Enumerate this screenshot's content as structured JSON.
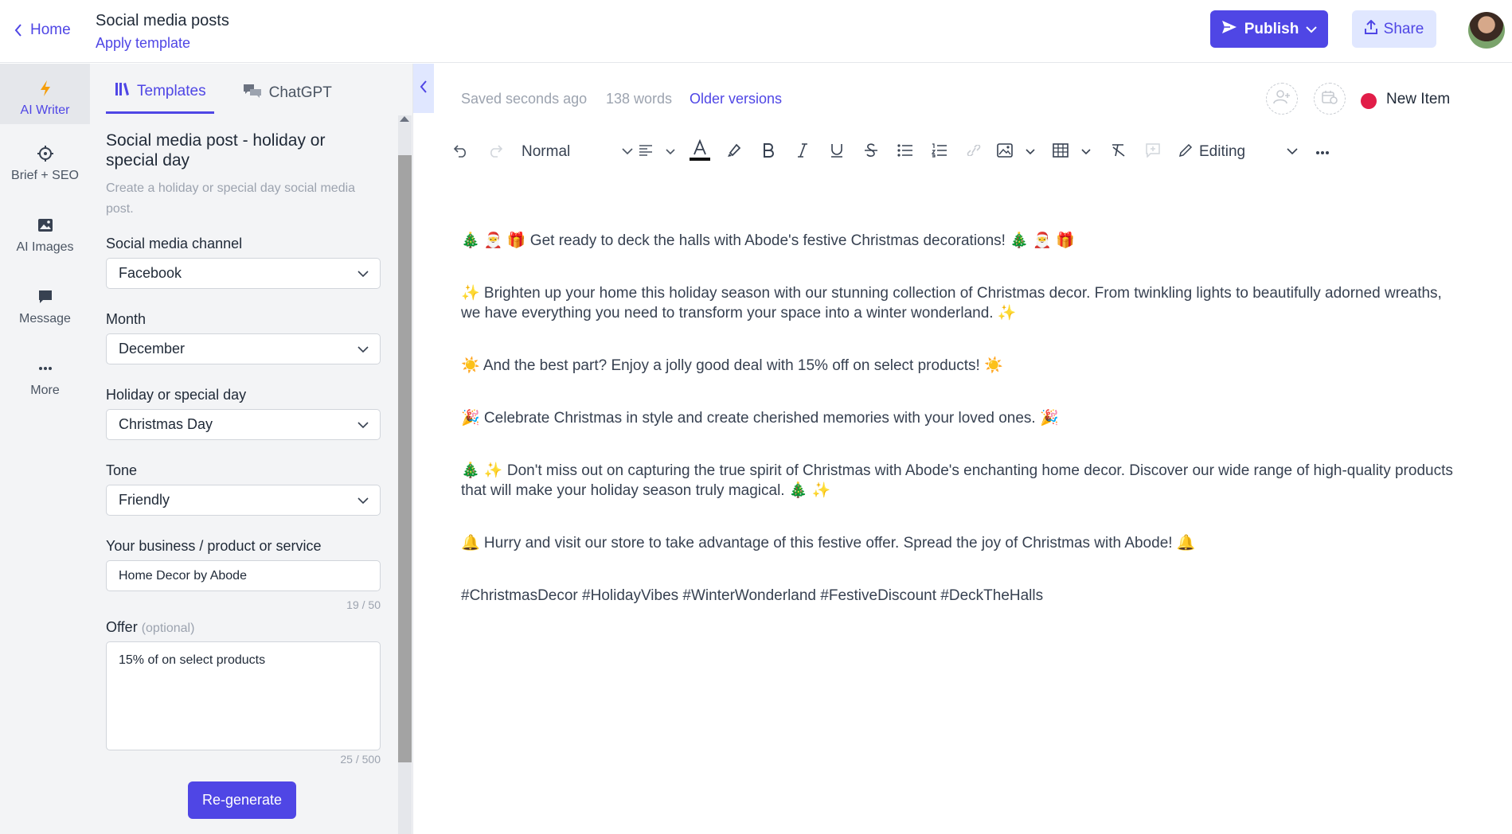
{
  "header": {
    "home_label": "Home",
    "doc_title": "Social media posts",
    "apply_template": "Apply template",
    "publish_label": "Publish",
    "share_label": "Share"
  },
  "sidenav": {
    "items": [
      {
        "label": "AI Writer",
        "icon": "lightning-icon"
      },
      {
        "label": "Brief + SEO",
        "icon": "crosshair-icon"
      },
      {
        "label": "AI Images",
        "icon": "image-icon"
      },
      {
        "label": "Message",
        "icon": "chat-bubble-icon"
      },
      {
        "label": "More",
        "icon": "ellipsis-icon"
      }
    ]
  },
  "panel": {
    "tabs": [
      {
        "label": "Templates",
        "icon": "library-icon"
      },
      {
        "label": "ChatGPT",
        "icon": "chat-icon"
      }
    ],
    "template_title": "Social media post - holiday or special day",
    "template_desc": "Create a holiday or special day social media post.",
    "fields": {
      "channel": {
        "label": "Social media channel",
        "value": "Facebook"
      },
      "month": {
        "label": "Month",
        "value": "December"
      },
      "holiday": {
        "label": "Holiday or special day",
        "value": "Christmas Day"
      },
      "tone": {
        "label": "Tone",
        "value": "Friendly"
      },
      "business": {
        "label": "Your business / product or service",
        "value": "Home Decor by Abode",
        "counter": "19 / 50"
      },
      "offer": {
        "label": "Offer",
        "optional": "(optional)",
        "value": "15% of on select products",
        "counter": "25 / 500"
      }
    },
    "regenerate_label": "Re-generate"
  },
  "editor_meta": {
    "saved": "Saved seconds ago",
    "words": "138 words",
    "older_versions": "Older versions",
    "status": "New Item",
    "status_color": "#e11d48"
  },
  "toolbar": {
    "style_value": "Normal",
    "mode_value": "Editing"
  },
  "content": {
    "paragraphs": [
      "🎄 🎅 🎁 Get ready to deck the halls with Abode's festive Christmas decorations! 🎄 🎅 🎁",
      "✨ Brighten up your home this holiday season with our stunning collection of Christmas decor. From twinkling lights to beautifully adorned wreaths, we have everything you need to transform your space into a winter wonderland. ✨",
      "☀️ And the best part? Enjoy a jolly good deal with 15% off on select products! ☀️",
      "🎉 Celebrate Christmas in style and create cherished memories with your loved ones. 🎉",
      "🎄 ✨ Don't miss out on capturing the true spirit of Christmas with Abode's enchanting home decor. Discover our wide range of high-quality products that will make your holiday season truly magical. 🎄 ✨",
      "🔔 Hurry and visit our store to take advantage of this festive offer. Spread the joy of Christmas with Abode! 🔔",
      "#ChristmasDecor #HolidayVibes #WinterWonderland #FestiveDiscount #DeckTheHalls"
    ]
  },
  "colors": {
    "accent": "#4f46e5",
    "accent_light": "#e0e7ff",
    "sidebar_bg": "#f3f4f6"
  }
}
